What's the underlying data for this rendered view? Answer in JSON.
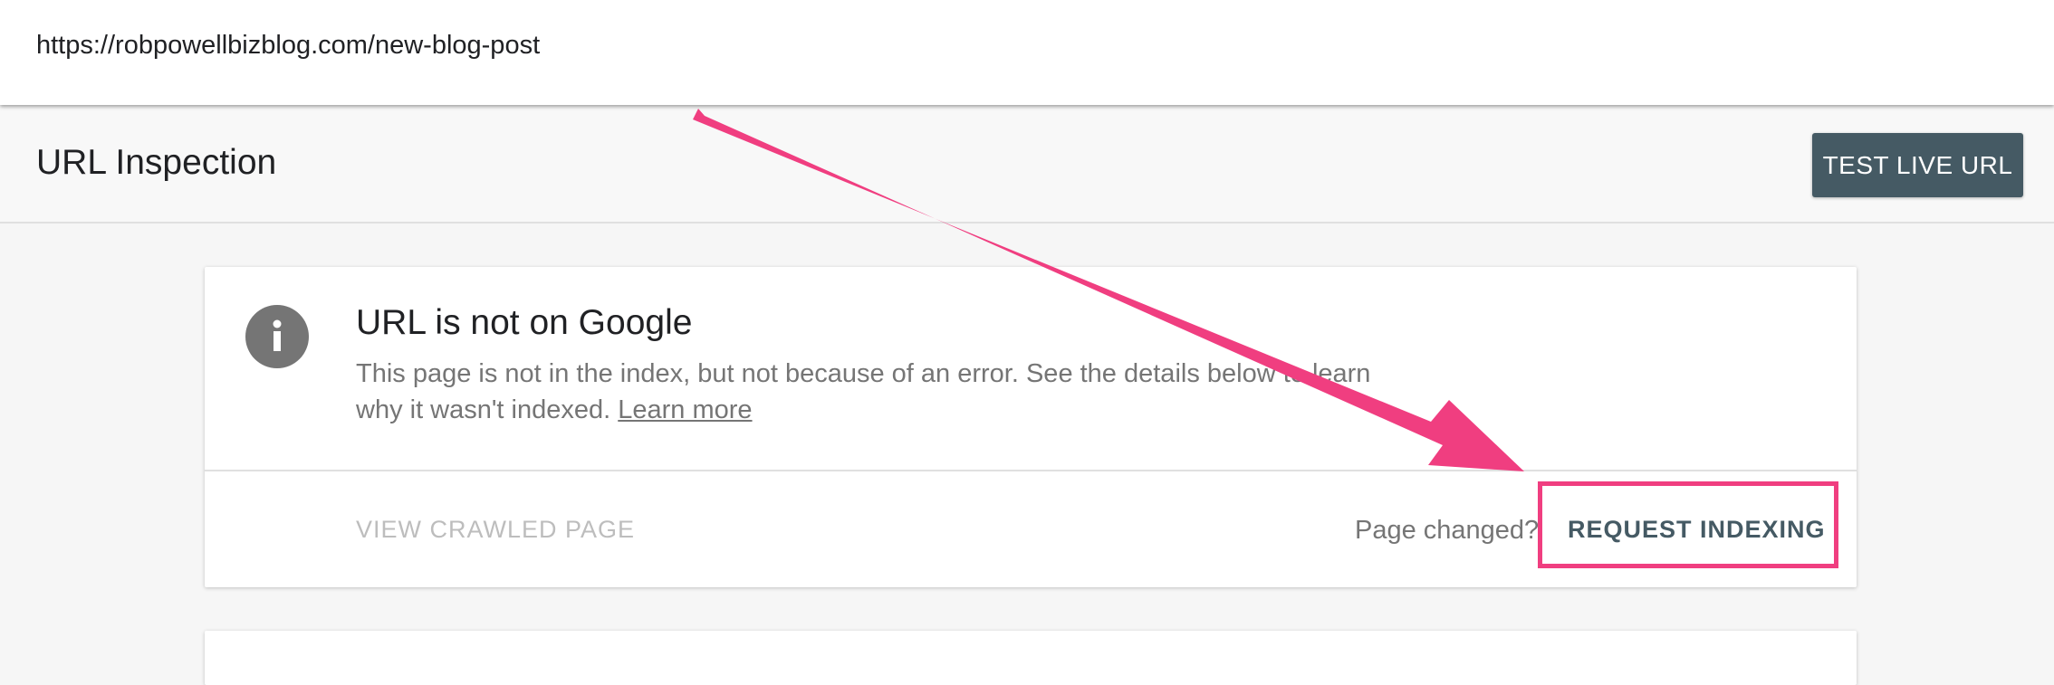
{
  "url_bar": {
    "value": "https://robpowellbizblog.com/new-blog-post"
  },
  "header": {
    "title": "URL Inspection",
    "test_live_label": "TEST LIVE URL"
  },
  "status_card": {
    "icon": "info-icon",
    "title": "URL is not on Google",
    "description": "This page is not in the index, but not because of an error. See the details below to learn why it wasn't indexed.",
    "learn_more": "Learn more",
    "view_crawled_label": "VIEW CRAWLED PAGE",
    "page_changed_text": "Page changed?",
    "request_indexing_label": "REQUEST INDEXING"
  },
  "colors": {
    "primary_button": "#455a64",
    "annotation": "#f03e80",
    "info_icon": "#757575"
  }
}
